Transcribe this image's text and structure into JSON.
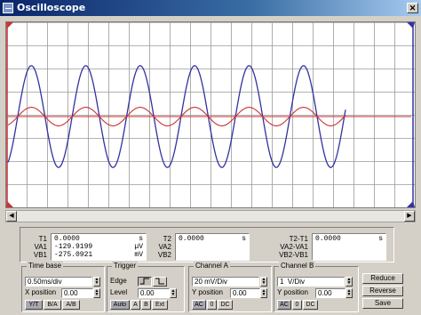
{
  "window": {
    "title": "Oscilloscope",
    "close_glyph": "✕"
  },
  "colors": {
    "channel_a": "#c83232",
    "channel_b": "#3232a0",
    "grid": "#9a9a9a",
    "cursor_1": "#c83232",
    "cursor_2": "#3232a0"
  },
  "readout": {
    "t1": {
      "labels": [
        "T1",
        "VA1",
        "VB1"
      ],
      "values": [
        "0.0000",
        "-129.9199",
        "-275.0921"
      ],
      "units": [
        "s",
        "µV",
        "mV"
      ]
    },
    "t2": {
      "labels": [
        "T2",
        "VA2",
        "VB2"
      ],
      "values": [
        "0.0000"
      ],
      "units": [
        "s"
      ]
    },
    "delta": {
      "labels": [
        "T2-T1",
        "VA2-VA1",
        "VB2-VB1"
      ],
      "values": [
        "0.0000"
      ],
      "units": [
        "s"
      ]
    }
  },
  "timebase": {
    "title": "Time base",
    "value": "0.50ms/div",
    "x_position_label": "X position",
    "x_position": "0.00",
    "modes": [
      "Y/T",
      "B/A",
      "A/B"
    ],
    "active_mode": "Y/T"
  },
  "trigger": {
    "title": "Trigger",
    "edge_label": "Edge",
    "level_label": "Level",
    "level": "0.00",
    "sources": [
      "Auto",
      "A",
      "B",
      "Ext"
    ]
  },
  "channel_a": {
    "title": "Channel A",
    "scale": "20 mV/Div",
    "y_position_label": "Y position",
    "y_position": "0.00",
    "coupling": [
      "AC",
      "0",
      "DC"
    ]
  },
  "channel_b": {
    "title": "Channel B",
    "scale": "1  V/Div",
    "y_position_label": "Y position",
    "y_position": "0.00",
    "coupling": [
      "AC",
      "0",
      "DC"
    ]
  },
  "buttons": {
    "reduce": "Reduce",
    "reverse": "Reverse",
    "save": "Save"
  },
  "trace": {
    "cycles": 6.2,
    "channel_a_amplitude_div": 0.4,
    "channel_b_amplitude_div": 2.2,
    "phase_offset_deg": 0
  }
}
